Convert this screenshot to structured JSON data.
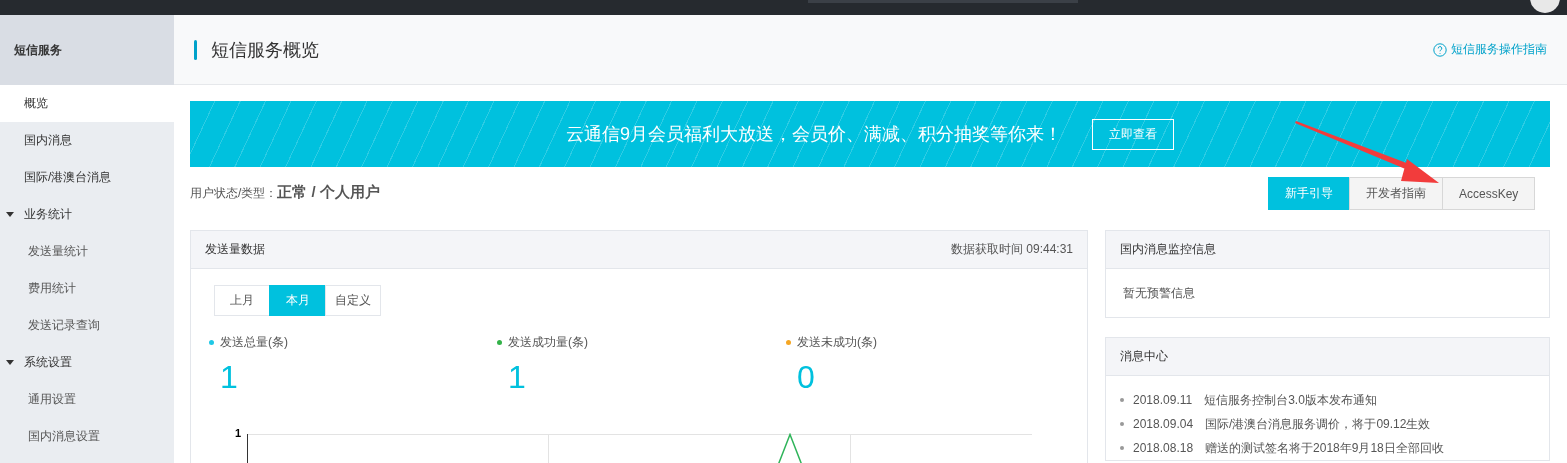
{
  "sidebar": {
    "title": "短信服务",
    "items": [
      {
        "label": "概览",
        "kind": "link",
        "selected": true
      },
      {
        "label": "国内消息",
        "kind": "link",
        "selected": false
      },
      {
        "label": "国际/港澳台消息",
        "kind": "link",
        "selected": false
      },
      {
        "label": "业务统计",
        "kind": "group",
        "expanded": true,
        "children": [
          {
            "label": "发送量统计",
            "selected": false
          },
          {
            "label": "费用统计",
            "selected": false
          },
          {
            "label": "发送记录查询",
            "selected": false
          }
        ]
      },
      {
        "label": "系统设置",
        "kind": "group",
        "expanded": true,
        "children": [
          {
            "label": "通用设置",
            "selected": false
          },
          {
            "label": "国内消息设置",
            "selected": false
          }
        ]
      }
    ]
  },
  "page": {
    "title": "短信服务概览",
    "help_link": "短信服务操作指南"
  },
  "banner": {
    "text": "云通信9月会员福利大放送，会员价、满减、积分抽奖等你来！",
    "button": "立即查看"
  },
  "user_status": {
    "label": "用户状态/类型：",
    "value": "正常 / 个人用户"
  },
  "quick_tabs": [
    {
      "label": "新手引导",
      "selected": true
    },
    {
      "label": "开发者指南",
      "selected": false
    },
    {
      "label": "AccessKey",
      "selected": false
    }
  ],
  "send_panel": {
    "title": "发送量数据",
    "fetch_time": "数据获取时间 09:44:31",
    "periods": [
      {
        "label": "上月",
        "selected": false
      },
      {
        "label": "本月",
        "selected": true
      },
      {
        "label": "自定义",
        "selected": false
      }
    ],
    "stats": [
      {
        "label": "发送总量(条)",
        "value": "1",
        "color": "#1fc8e6"
      },
      {
        "label": "发送成功量(条)",
        "value": "1",
        "color": "#33b249"
      },
      {
        "label": "发送未成功(条)",
        "value": "0",
        "color": "#f5a623"
      }
    ],
    "chart": {
      "y_tick": "1"
    }
  },
  "monitor_panel": {
    "title": "国内消息监控信息",
    "message": "暂无预警信息"
  },
  "news_panel": {
    "title": "消息中心",
    "items": [
      {
        "date": "2018.09.11",
        "text": "短信服务控制台3.0版本发布通知"
      },
      {
        "date": "2018.09.04",
        "text": "国际/港澳台消息服务调价，将于09.12生效"
      },
      {
        "date": "2018.08.18",
        "text": "赠送的测试签名将于2018年9月18日全部回收"
      }
    ]
  }
}
